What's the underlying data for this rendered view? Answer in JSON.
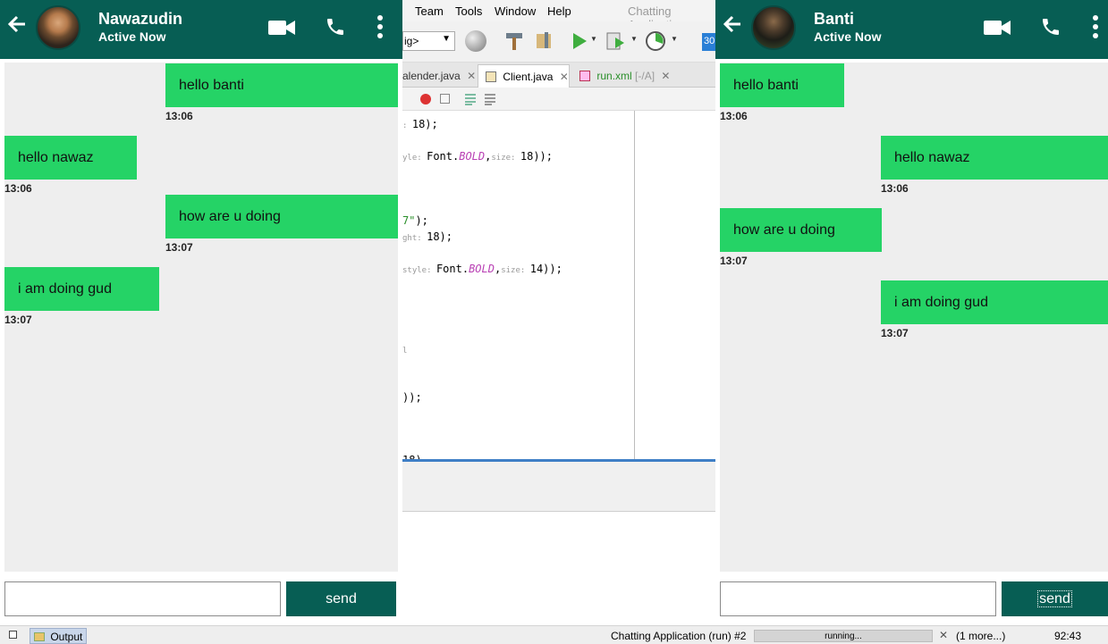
{
  "ide": {
    "menu": [
      "Team",
      "Tools",
      "Window",
      "Help"
    ],
    "window_title": "Chatting Applicatio",
    "config_combo": "ig>",
    "toolbar_badge": "30",
    "tabs": [
      {
        "label": "alender.java"
      },
      {
        "label": "Client.java"
      },
      {
        "label": "run.xml",
        "suffix": "[-/A]"
      }
    ],
    "code": [
      {
        "segments": [
          {
            "t": ": ",
            "c": "#9a9a9a"
          },
          {
            "t": "18);",
            "c": "#000"
          }
        ]
      },
      {
        "segments": [
          {
            "t": "yle: ",
            "c": "#9a9a9a"
          },
          {
            "t": "Font.",
            "c": "#000"
          },
          {
            "t": "BOLD",
            "c": "#b940b4",
            "i": true
          },
          {
            "t": ",",
            "c": "#000"
          },
          {
            "t": "size: ",
            "c": "#9a9a9a"
          },
          {
            "t": "18));",
            "c": "#000"
          }
        ]
      },
      {
        "segments": [
          {
            "t": "7\"",
            "c": "#2a8f2a"
          },
          {
            "t": ");",
            "c": "#000"
          }
        ]
      },
      {
        "segments": [
          {
            "t": "ght: ",
            "c": "#9a9a9a"
          },
          {
            "t": "18);",
            "c": "#000"
          }
        ]
      },
      {
        "segments": [
          {
            "t": " style: ",
            "c": "#9a9a9a"
          },
          {
            "t": "Font.",
            "c": "#000"
          },
          {
            "t": "BOLD",
            "c": "#b940b4",
            "i": true
          },
          {
            "t": ",",
            "c": "#000"
          },
          {
            "t": "size: ",
            "c": "#9a9a9a"
          },
          {
            "t": "14));",
            "c": "#000"
          }
        ]
      },
      {
        "segments": [
          {
            "t": "l",
            "c": "#9a9a9a"
          }
        ]
      },
      {
        "segments": [
          {
            "t": "));",
            "c": "#000"
          }
        ]
      },
      {
        "segments": [
          {
            "t": " 18)",
            "c": "#000"
          }
        ]
      }
    ]
  },
  "left_chat": {
    "name": "Nawazudin",
    "status": "Active Now",
    "messages": [
      {
        "text": "hello banti",
        "time": "13:06",
        "side": "right"
      },
      {
        "text": "hello nawaz",
        "time": "13:06",
        "side": "left"
      },
      {
        "text": "how are u doing",
        "time": "13:07",
        "side": "right"
      },
      {
        "text": "i am doing gud",
        "time": "13:07",
        "side": "left"
      }
    ],
    "input_value": "",
    "send_label": "send"
  },
  "right_chat": {
    "name": "Banti",
    "status": "Active Now",
    "messages": [
      {
        "text": "hello banti",
        "time": "13:06",
        "side": "left"
      },
      {
        "text": "hello nawaz",
        "time": "13:06",
        "side": "right"
      },
      {
        "text": "how are u doing",
        "time": "13:07",
        "side": "left"
      },
      {
        "text": "i am doing gud",
        "time": "13:07",
        "side": "right"
      }
    ],
    "input_value": "",
    "send_label": "send"
  },
  "statusbar": {
    "output_tab": "Output",
    "task": "Chatting Application (run) #2",
    "progress_text": "running...",
    "more": "(1 more...)",
    "position": "92:43"
  },
  "colors": {
    "header": "#075e54",
    "bubble": "#25d366",
    "chat_bg": "#eeeeee",
    "send_button": "#075e54"
  }
}
